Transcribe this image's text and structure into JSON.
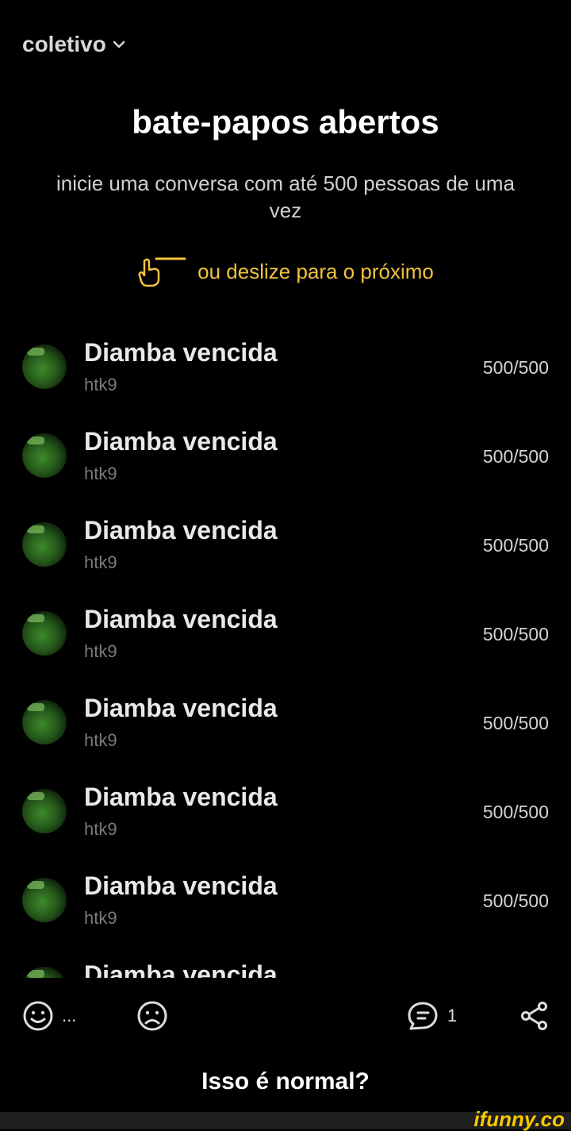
{
  "header": {
    "community": "coletivo"
  },
  "main": {
    "title": "bate-papos abertos",
    "subtitle": "inicie uma conversa com até 500 pessoas de uma vez",
    "swipe_hint": "ou deslize para o próximo",
    "accent_color": "#f2c23e"
  },
  "chats": [
    {
      "name": "Diamba vencida",
      "host": "htk9",
      "members": "500/500"
    },
    {
      "name": "Diamba vencida",
      "host": "htk9",
      "members": "500/500"
    },
    {
      "name": "Diamba vencida",
      "host": "htk9",
      "members": "500/500"
    },
    {
      "name": "Diamba vencida",
      "host": "htk9",
      "members": "500/500"
    },
    {
      "name": "Diamba vencida",
      "host": "htk9",
      "members": "500/500"
    },
    {
      "name": "Diamba vencida",
      "host": "htk9",
      "members": "500/500"
    },
    {
      "name": "Diamba vencida",
      "host": "htk9",
      "members": "500/500"
    },
    {
      "name": "Diamba vencida",
      "host": "",
      "members": ""
    }
  ],
  "actions": {
    "smile_more": "...",
    "comment_count": "1",
    "icons": [
      "smile-icon",
      "sad-face-icon",
      "comment-icon",
      "share-icon"
    ]
  },
  "post": {
    "caption": "Isso é normal?"
  },
  "watermark": "ifunny.co"
}
